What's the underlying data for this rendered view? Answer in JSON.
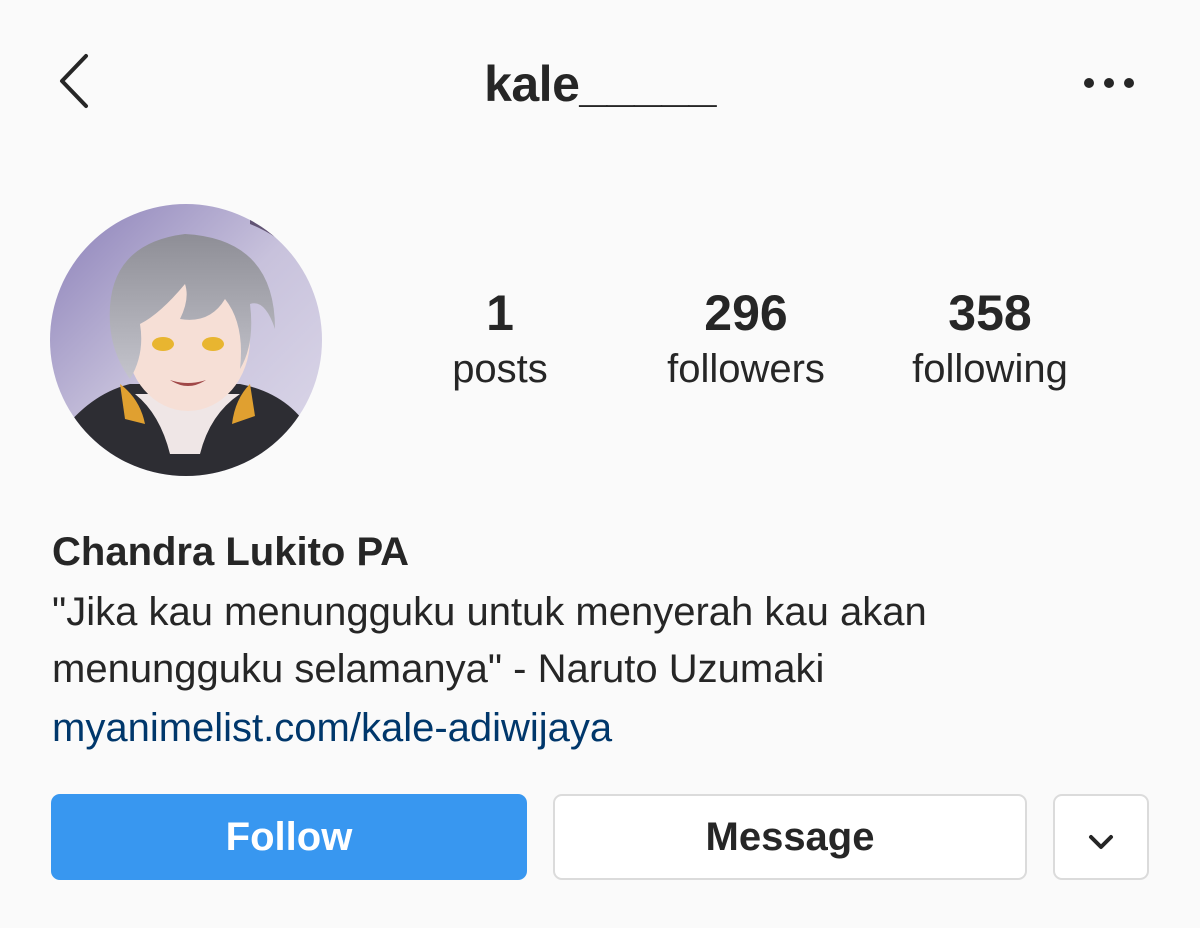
{
  "header": {
    "username": "kale_____",
    "back_icon": "chevron-left-icon",
    "more_icon": "more-horizontal-icon"
  },
  "profile": {
    "avatar_icon": "avatar",
    "stats": [
      {
        "value": "1",
        "label": "posts"
      },
      {
        "value": "296",
        "label": "followers"
      },
      {
        "value": "358",
        "label": "following"
      }
    ],
    "full_name": "Chandra Lukito PA",
    "bio": "\"Jika kau menungguku untuk menyerah kau akan\nmenungguku selamanya\" - Naruto Uzumaki",
    "link": "myanimelist.com/kale-adiwijaya"
  },
  "actions": {
    "follow_label": "Follow",
    "message_label": "Message",
    "dropdown_icon": "chevron-down-icon"
  },
  "colors": {
    "accent": "#3897f0",
    "link": "#00376b",
    "text": "#262626",
    "background": "#fafafa",
    "border": "#dbdbdb"
  }
}
